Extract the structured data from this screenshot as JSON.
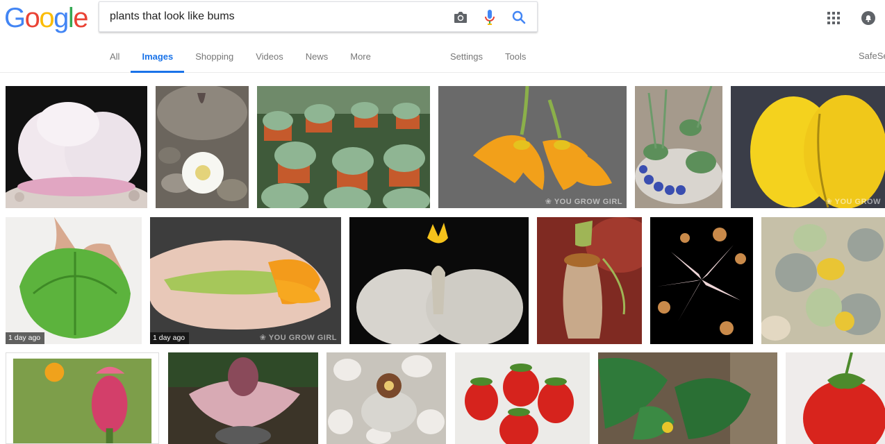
{
  "logo": {
    "letters": [
      "G",
      "o",
      "o",
      "g",
      "l",
      "e"
    ],
    "colors": [
      "#4285F4",
      "#EA4335",
      "#FBBC05",
      "#4285F4",
      "#34A853",
      "#EA4335"
    ]
  },
  "search": {
    "query": "plants that look like bums"
  },
  "icons": {
    "camera": "camera-icon",
    "mic": "microphone-icon",
    "search": "search-icon",
    "apps": "apps-grid-icon",
    "notifications": "notifications-icon"
  },
  "tabs": [
    {
      "label": "All",
      "active": false
    },
    {
      "label": "Images",
      "active": true
    },
    {
      "label": "Shopping",
      "active": false
    },
    {
      "label": "Videos",
      "active": false
    },
    {
      "label": "News",
      "active": false
    },
    {
      "label": "More",
      "active": false
    }
  ],
  "tools": {
    "settings": "Settings",
    "tools": "Tools"
  },
  "safesearch": "SafeSe",
  "accent": "#1a73e8",
  "images": {
    "r1_1": {
      "watermark": "",
      "badge": ""
    },
    "r1_4": {
      "watermark": "❀ YOU GROW GIRL"
    },
    "r1_6": {
      "watermark": "❀ YOU GROW"
    },
    "r2_1": {
      "badge": "1 day ago"
    },
    "r2_2": {
      "badge": "1 day ago",
      "watermark": "❀ YOU GROW GIRL"
    }
  }
}
